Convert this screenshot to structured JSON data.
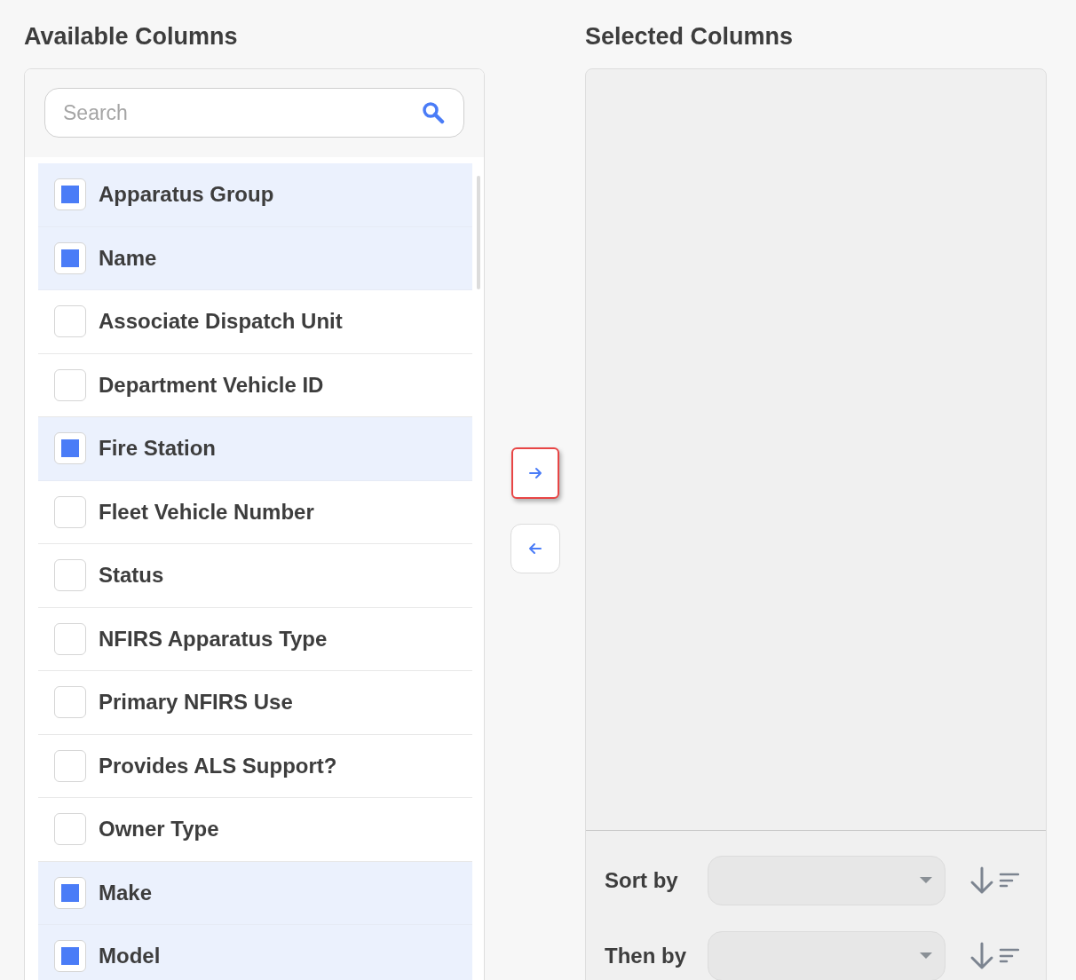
{
  "available": {
    "title": "Available Columns",
    "search": {
      "placeholder": "Search"
    },
    "items": [
      {
        "label": "Apparatus Group",
        "checked": true
      },
      {
        "label": "Name",
        "checked": true
      },
      {
        "label": "Associate Dispatch Unit",
        "checked": false
      },
      {
        "label": "Department Vehicle ID",
        "checked": false
      },
      {
        "label": "Fire Station",
        "checked": true
      },
      {
        "label": "Fleet Vehicle Number",
        "checked": false
      },
      {
        "label": "Status",
        "checked": false
      },
      {
        "label": "NFIRS Apparatus Type",
        "checked": false
      },
      {
        "label": "Primary NFIRS Use",
        "checked": false
      },
      {
        "label": "Provides ALS Support?",
        "checked": false
      },
      {
        "label": "Owner Type",
        "checked": false
      },
      {
        "label": "Make",
        "checked": true
      },
      {
        "label": "Model",
        "checked": true
      }
    ]
  },
  "transfer_buttons": [
    {
      "kind": "right",
      "highlighted": true
    },
    {
      "kind": "left",
      "highlighted": false
    }
  ],
  "selected": {
    "title": "Selected Columns",
    "sort_rows": [
      {
        "label": "Sort by"
      },
      {
        "label": "Then by"
      }
    ]
  }
}
